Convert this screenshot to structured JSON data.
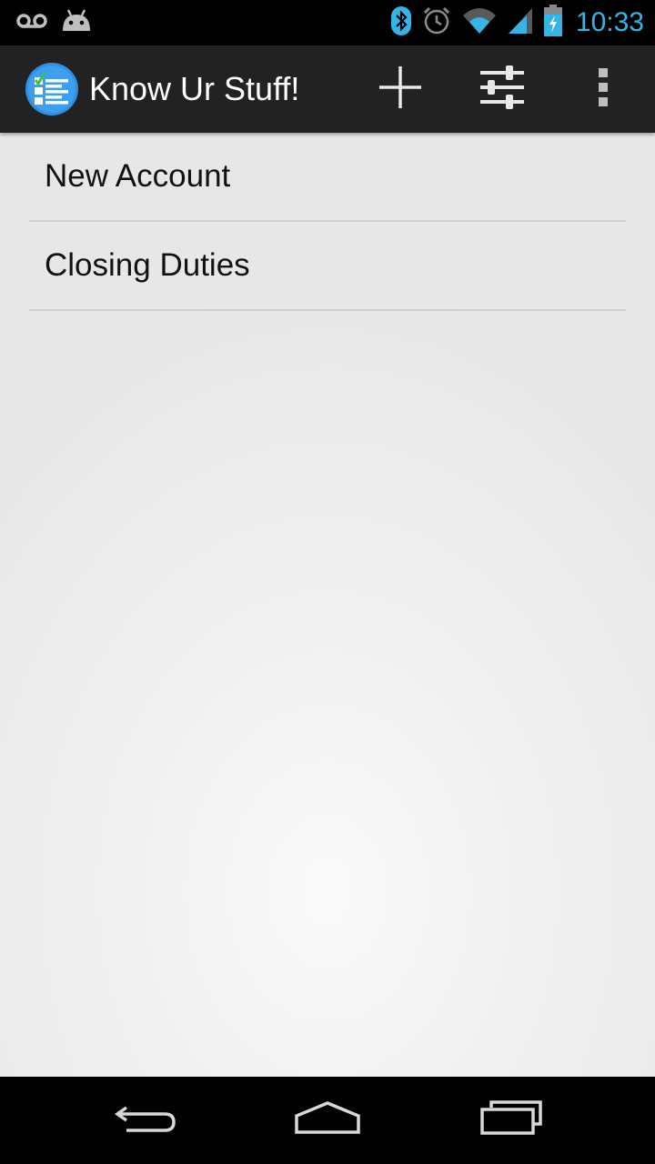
{
  "status_bar": {
    "time": "10:33",
    "left_icons": [
      "voicemail-icon",
      "android-debug-icon"
    ],
    "right_icons": [
      "bluetooth-icon",
      "alarm-icon",
      "wifi-icon",
      "signal-icon",
      "battery-charging-icon"
    ],
    "time_color": "#33b5e5"
  },
  "action_bar": {
    "title": "Know Ur Stuff!",
    "app_icon": "checklist-app-icon",
    "actions": [
      "add-icon",
      "settings-sliders-icon",
      "overflow-menu-icon"
    ],
    "background": "#222222"
  },
  "list": {
    "items": [
      {
        "label": "New Account"
      },
      {
        "label": "Closing Duties"
      }
    ]
  },
  "nav_bar": {
    "buttons": [
      "back-icon",
      "home-icon",
      "recent-apps-icon"
    ]
  }
}
